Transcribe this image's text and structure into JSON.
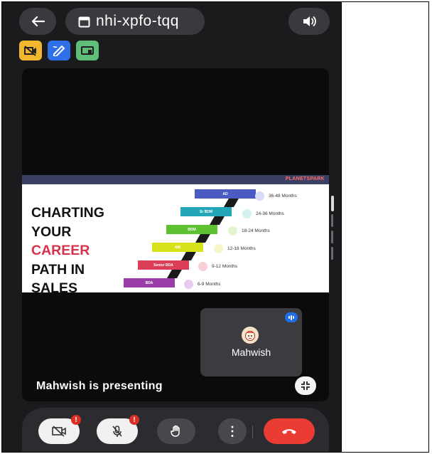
{
  "meeting": {
    "code": "nhi-xpfo-tqq"
  },
  "colors": {
    "chip_yellow": "#f1b72e",
    "chip_blue": "#2f6fe8",
    "chip_green": "#5fbf7a",
    "end_call": "#ea3c32"
  },
  "slide": {
    "brand": "PLANETSPARK",
    "title_lines": [
      "CHARTING",
      "YOUR",
      "CAREER",
      "PATH IN",
      "SALES"
    ],
    "steps": [
      {
        "label": "AD",
        "duration": "36-48 Months",
        "color": "#4b5bc4"
      },
      {
        "label": "Sr BDM",
        "duration": "24-36 Months",
        "color": "#22a6b8"
      },
      {
        "label": "BDM",
        "duration": "18-24 Months",
        "color": "#5fc032"
      },
      {
        "label": "AM",
        "duration": "12-18 Months",
        "color": "#d6e21a"
      },
      {
        "label": "Senior BDA",
        "duration": "9-12 Months",
        "color": "#dc3e57"
      },
      {
        "label": "BDA",
        "duration": "6-9 Months",
        "color": "#9b3fa8"
      }
    ]
  },
  "participant": {
    "name": "Mahwish"
  },
  "status": {
    "presenting": "Mahwish  is presenting"
  },
  "controls": {
    "camera_alert": "!",
    "mic_alert": "!",
    "more": "⋮"
  }
}
